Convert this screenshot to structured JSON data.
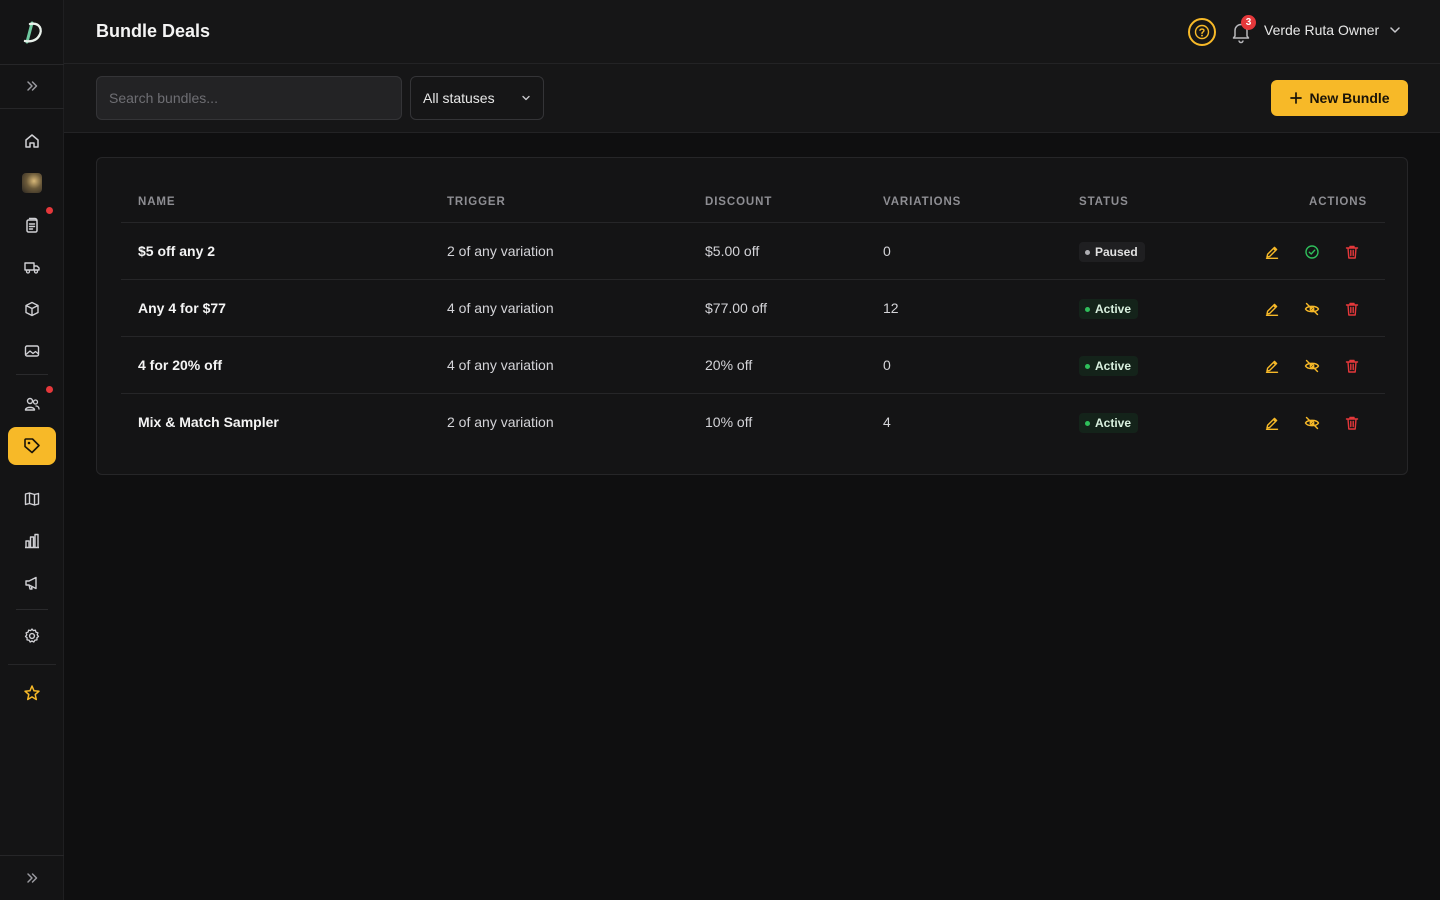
{
  "header": {
    "title": "Bundle Deals",
    "notification_count": "3",
    "user_name": "Verde Ruta Owner"
  },
  "toolbar": {
    "search_placeholder": "Search bundles...",
    "status_filter": "All statuses",
    "new_button_label": "New Bundle"
  },
  "sidebar": {
    "items": [
      {
        "icon": "home-icon"
      },
      {
        "icon": "store-thumbnail"
      },
      {
        "icon": "orders-icon",
        "has_alert": true
      },
      {
        "icon": "truck-icon"
      },
      {
        "icon": "box-icon"
      },
      {
        "icon": "image-icon"
      },
      {
        "icon": "users-icon",
        "has_alert": true
      },
      {
        "icon": "tag-icon",
        "active": true
      },
      {
        "icon": "book-icon"
      },
      {
        "icon": "analytics-icon"
      },
      {
        "icon": "megaphone-icon"
      },
      {
        "icon": "settings-icon"
      },
      {
        "icon": "star-icon"
      }
    ]
  },
  "table": {
    "columns": [
      "NAME",
      "TRIGGER",
      "DISCOUNT",
      "VARIATIONS",
      "STATUS",
      "ACTIONS"
    ],
    "rows": [
      {
        "name": "$5 off any 2",
        "trigger": "2 of any variation",
        "discount": "$5.00 off",
        "variations": "0",
        "status": "Paused"
      },
      {
        "name": "Any 4 for $77",
        "trigger": "4 of any variation",
        "discount": "$77.00 off",
        "variations": "12",
        "status": "Active"
      },
      {
        "name": "4 for 20% off",
        "trigger": "4 of any variation",
        "discount": "20% off",
        "variations": "0",
        "status": "Active"
      },
      {
        "name": "Mix & Match Sampler",
        "trigger": "2 of any variation",
        "discount": "10% off",
        "variations": "4",
        "status": "Active"
      }
    ]
  },
  "colors": {
    "accent": "#f7b928",
    "danger": "#e5383b",
    "success": "#2fbf5b",
    "background": "#0f0f10"
  }
}
